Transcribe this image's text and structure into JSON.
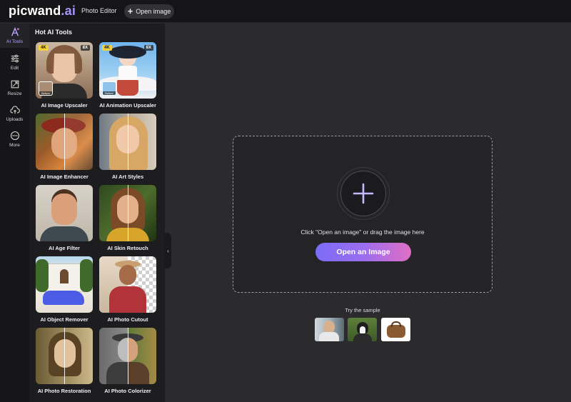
{
  "brand": {
    "name_main": "picwand",
    "name_suffix": ".ai"
  },
  "header": {
    "nav_photo_editor": "Photo Editor",
    "open_image_label": "Open image"
  },
  "rail": {
    "items": [
      {
        "label": "AI Tools",
        "icon": "ai-tools-icon"
      },
      {
        "label": "Edit",
        "icon": "sliders-icon"
      },
      {
        "label": "Resize",
        "icon": "resize-icon"
      },
      {
        "label": "Uploads",
        "icon": "cloud-upload-icon"
      },
      {
        "label": "More",
        "icon": "more-icon"
      }
    ]
  },
  "panel": {
    "title": "Hot AI Tools",
    "tools": [
      {
        "label": "AI Image Upscaler",
        "badge_quality": "4K",
        "badge_scale": "8X",
        "mini_label": "Before"
      },
      {
        "label": "AI Animation Upscaler",
        "badge_quality": "4K",
        "badge_scale": "8X",
        "mini_label": "Before"
      },
      {
        "label": "AI Image Enhancer"
      },
      {
        "label": "AI Art Styles"
      },
      {
        "label": "AI Age Filter"
      },
      {
        "label": "AI Skin Retouch"
      },
      {
        "label": "AI Object Remover"
      },
      {
        "label": "AI Photo Cutout"
      },
      {
        "label": "AI Photo Restoration"
      },
      {
        "label": "AI Photo Colorizer"
      }
    ]
  },
  "main": {
    "drop_hint": "Click \"Open an image\" or drag the image here",
    "cta_label": "Open an Image",
    "sample_title": "Try the sample"
  },
  "colors": {
    "accent": "#a993ff",
    "cta_start": "#7b6cf6",
    "cta_end": "#e06fc4",
    "badge_yellow": "#f3d13c"
  }
}
